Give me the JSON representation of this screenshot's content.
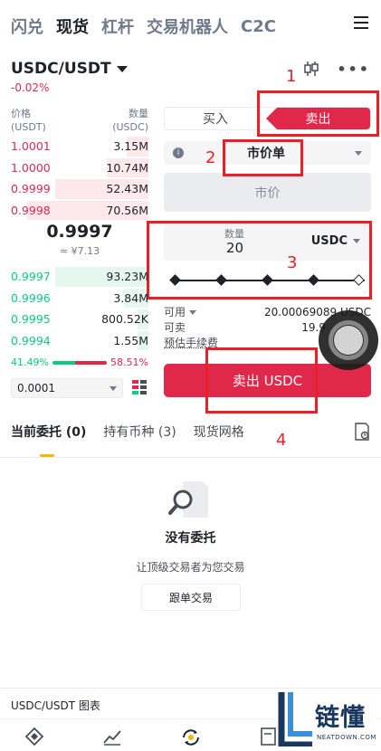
{
  "topnav": {
    "tabs": [
      "闪兑",
      "现货",
      "杠杆",
      "交易机器人",
      "C2C"
    ],
    "active": "现货"
  },
  "pair": {
    "symbol": "USDC/USDT",
    "change": "-0.02%"
  },
  "orderbook": {
    "price_header": "价格",
    "price_unit": "(USDT)",
    "qty_header": "数量",
    "qty_unit": "(USDC)",
    "asks": [
      {
        "price": "1.0001",
        "qty": "3.15M"
      },
      {
        "price": "1.0000",
        "qty": "10.74M"
      },
      {
        "price": "0.9999",
        "qty": "52.43M"
      },
      {
        "price": "0.9998",
        "qty": "70.56M"
      }
    ],
    "mid_price": "0.9997",
    "mid_fiat": "≈ ¥7.13",
    "bids": [
      {
        "price": "0.9997",
        "qty": "93.23M"
      },
      {
        "price": "0.9996",
        "qty": "3.84M"
      },
      {
        "price": "0.9995",
        "qty": "800.52K"
      },
      {
        "price": "0.9994",
        "qty": "1.55M"
      }
    ],
    "buy_ratio": "41.49%",
    "sell_ratio": "58.51%",
    "buy_ratio_value": 41.49,
    "precision": "0.0001"
  },
  "order_form": {
    "buy_tab": "买入",
    "sell_tab": "卖出",
    "order_type": "市价单",
    "price_placeholder": "市价",
    "amount_label": "数量",
    "amount_value": "20",
    "amount_unit": "USDC",
    "available_label": "可用",
    "available_value": "20.00069089 USDC",
    "sellable_label": "可卖",
    "sellable_value": "19.9",
    "fee_label": "预估手续费",
    "submit_label": "卖出 USDC"
  },
  "annotations": [
    "1",
    "2",
    "3",
    "4"
  ],
  "orders": {
    "tabs": [
      "当前委托 (0)",
      "持有币种 (3)",
      "现货网格"
    ],
    "empty_title": "没有委托",
    "empty_subtitle": "让顶级交易者为您交易",
    "copy_button": "跟单交易"
  },
  "footer": {
    "chart_link": "USDC/USDT 图表"
  },
  "watermark": {
    "cn": "链懂",
    "en": "NEATDOWN.COM"
  },
  "colors": {
    "sell": "#e0294a",
    "buy": "#0ecb81",
    "accent": "#f0b90b",
    "annotation": "#e8202a"
  }
}
